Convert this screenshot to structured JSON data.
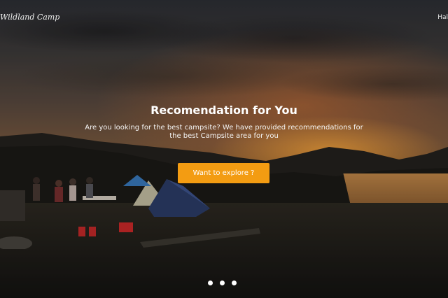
{
  "header": {
    "brand": "Wildland Camp",
    "nav_link": "Hal"
  },
  "hero": {
    "title": "Recomendation for You",
    "subtitle": "Are you looking for the best campsite? We have provided recommendations for the best Campsite area for you",
    "cta_label": "Want to explore ?"
  },
  "carousel": {
    "slides": 3
  },
  "colors": {
    "accent": "#f39c12",
    "text": "#ffffff"
  }
}
